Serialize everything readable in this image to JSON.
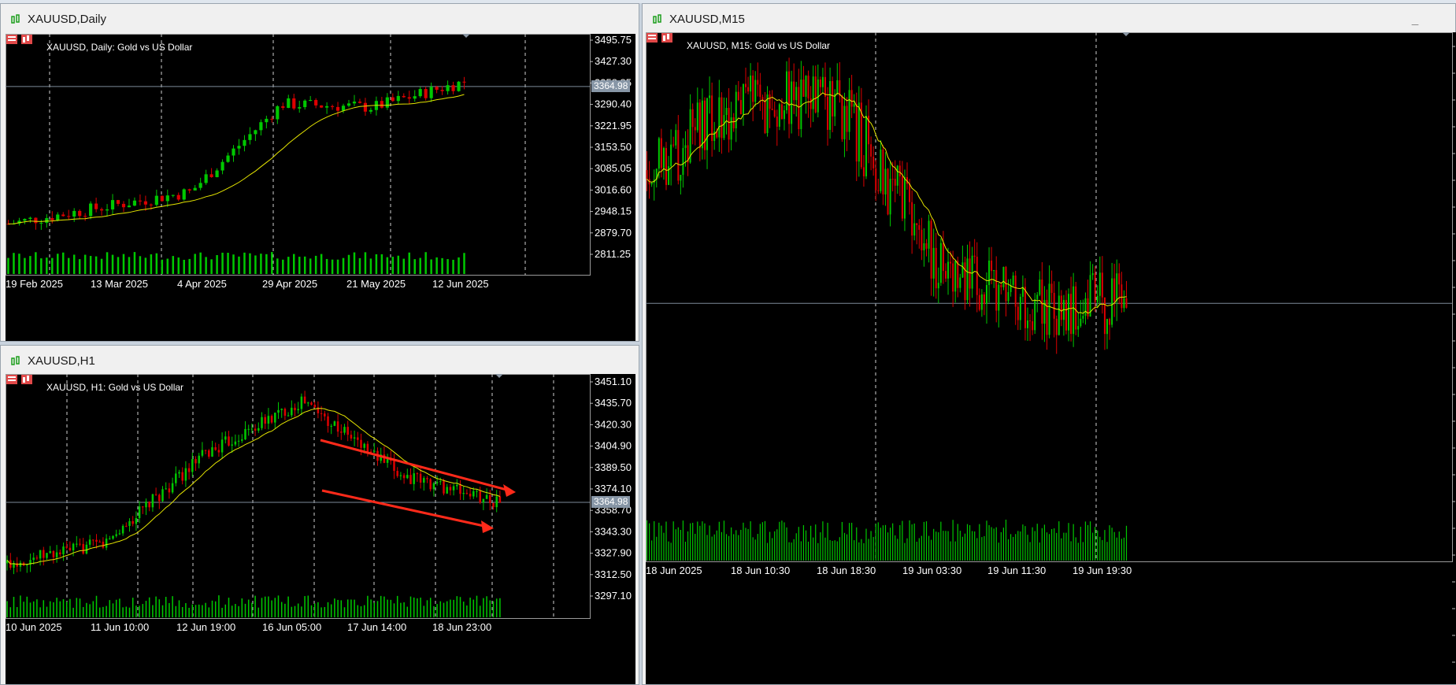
{
  "colors": {
    "bull": "#00c800",
    "bear": "#dc0000",
    "ma": "#e6e600",
    "grid": "#cfcfcf",
    "volume": "#00c800",
    "arrow": "#ff2a1a",
    "priceLine": "#7d8a99"
  },
  "windows": [
    {
      "title": "XAUUSD,Daily",
      "label": "XAUUSD, Daily:  Gold vs US Dollar",
      "price_axis": [
        "3495.75",
        "3427.30",
        "3358.85",
        "3290.40",
        "3221.95",
        "3153.50",
        "3085.05",
        "3016.60",
        "2948.15",
        "2879.70",
        "2811.25"
      ],
      "price_range": [
        2800,
        3510
      ],
      "time_axis": [
        "19 Feb 2025",
        "13 Mar 2025",
        "4 Apr 2025",
        "29 Apr 2025",
        "21 May 2025",
        "12 Jun 2025"
      ],
      "current_price": "3364.98",
      "controls": {
        "minimize": "_",
        "maximize": "□",
        "close": "✕"
      }
    },
    {
      "title": "XAUUSD,H1",
      "label": "XAUUSD, H1:  Gold vs US Dollar",
      "price_axis": [
        "3451.10",
        "3435.70",
        "3420.30",
        "3404.90",
        "3389.50",
        "3374.10",
        "3358.70",
        "3343.30",
        "3327.90",
        "3312.50",
        "3297.10"
      ],
      "price_range": [
        3290,
        3455
      ],
      "time_axis": [
        "10 Jun 2025",
        "11 Jun 10:00",
        "12 Jun 19:00",
        "16 Jun 05:00",
        "17 Jun 14:00",
        "18 Jun 23:00"
      ],
      "current_price": "3364.98",
      "controls": {
        "minimize": "_",
        "maximize": "□",
        "close": "✕"
      }
    },
    {
      "title": "XAUUSD,M15",
      "label": "XAUUSD, M15:  Gold vs US Dollar",
      "price_range": [
        3330,
        3405
      ],
      "time_axis": [
        "18 Jun 2025",
        "18 Jun 10:30",
        "18 Jun 18:30",
        "19 Jun 03:30",
        "19 Jun 11:30",
        "19 Jun 19:30"
      ],
      "current_price": "3364.98",
      "controls": {
        "minimize": "_"
      }
    }
  ],
  "chart_data": [
    {
      "type": "candlestick",
      "title": "XAUUSD, Daily:  Gold vs US Dollar",
      "x": [
        "19 Feb 2025",
        "13 Mar 2025",
        "4 Apr 2025",
        "29 Apr 2025",
        "21 May 2025",
        "12 Jun 2025"
      ],
      "close": [
        2935,
        2985,
        3035,
        3310,
        3300,
        3380
      ],
      "ylim": [
        2800,
        3510
      ],
      "current": 3364.98
    },
    {
      "type": "candlestick",
      "title": "XAUUSD, H1:  Gold vs US Dollar",
      "x": [
        "10 Jun 2025",
        "11 Jun 10:00",
        "12 Jun 19:00",
        "16 Jun 05:00",
        "17 Jun 14:00",
        "18 Jun 23:00"
      ],
      "close": [
        3320,
        3335,
        3400,
        3440,
        3385,
        3365
      ],
      "ylim": [
        3290,
        3455
      ],
      "current": 3364.98
    },
    {
      "type": "candlestick",
      "title": "XAUUSD, M15:  Gold vs US Dollar",
      "x": [
        "18 Jun 2025",
        "18 Jun 10:30",
        "18 Jun 18:30",
        "19 Jun 03:30",
        "19 Jun 11:30",
        "19 Jun 19:30"
      ],
      "close": [
        3385,
        3395,
        3395,
        3372,
        3364,
        3365
      ],
      "ylim": [
        3330,
        3405
      ],
      "current": 3364.98
    }
  ]
}
